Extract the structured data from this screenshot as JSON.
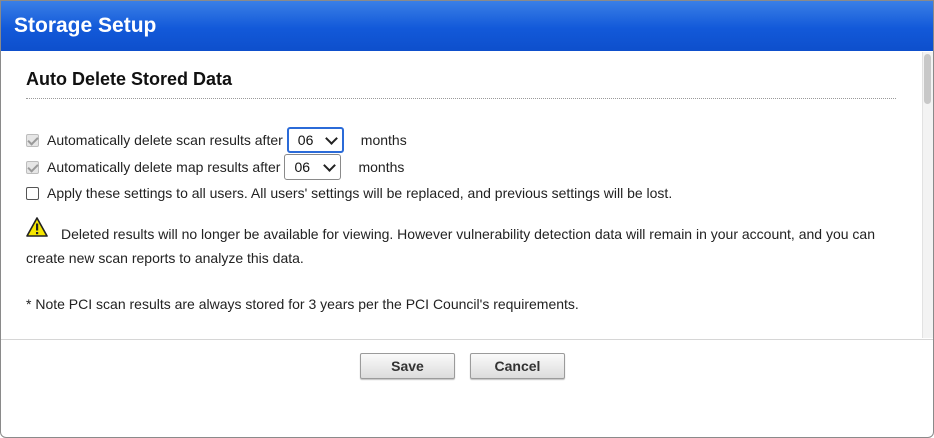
{
  "dialog": {
    "title": "Storage Setup"
  },
  "section": {
    "title": "Auto Delete Stored Data"
  },
  "settings": {
    "scan": {
      "label": "Automatically delete scan results after",
      "checked": true,
      "value": "06",
      "unit": "months"
    },
    "map": {
      "label": "Automatically delete map results after",
      "checked": true,
      "value": "06",
      "unit": "months"
    },
    "apply_all": {
      "label": "Apply these settings to all users. All users' settings will be replaced, and previous settings will be lost.",
      "checked": false
    }
  },
  "warning": {
    "icon": "warning-triangle-icon",
    "text": "Deleted results will no longer be available for viewing. However vulnerability detection data will remain in your account, and you can create new scan reports to analyze this data."
  },
  "note": "* Note PCI scan results are always stored for 3 years per the PCI Council's requirements.",
  "buttons": {
    "save": "Save",
    "cancel": "Cancel"
  },
  "colors": {
    "titlebar": "#1259d9",
    "warning_fill": "#f5e600",
    "select_focus": "#2b6bd8"
  }
}
